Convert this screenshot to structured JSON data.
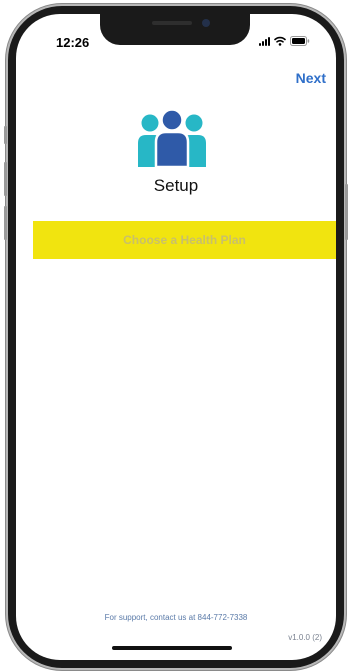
{
  "status_bar": {
    "time": "12:26",
    "icons": [
      "cellular-signal-icon",
      "wifi-icon",
      "battery-icon"
    ]
  },
  "nav": {
    "next_label": "Next",
    "accent_color": "#2f6fc9"
  },
  "header": {
    "logo_icon": "users-group-icon",
    "title": "Setup"
  },
  "main": {
    "choose_plan_label": "Choose a Health Plan",
    "button_color": "#f1e40f"
  },
  "footer": {
    "support_text": "For support, contact us at 844-772-7338",
    "version": "v1.0.0 (2)"
  }
}
